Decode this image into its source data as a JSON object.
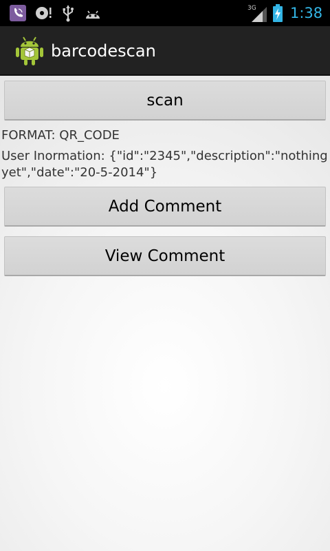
{
  "status_bar": {
    "time": "1:38",
    "network_type": "3G",
    "icons": [
      "viber-icon",
      "disc-icon",
      "usb-icon",
      "android-icon",
      "signal-icon",
      "battery-charging-icon"
    ],
    "clock_color": "#33b5e5"
  },
  "action_bar": {
    "title": "barcodescan",
    "icon": "android-app-icon",
    "brand_color": "#a4c639"
  },
  "main": {
    "scan_label": "scan",
    "format_line": "FORMAT: QR_CODE",
    "info_line1": "User Inormation: {\"id\":\"2345\",\"description\":\"nothing",
    "info_line2": "yet\",\"date\":\"20-5-2014\"}",
    "add_comment_label": "Add Comment",
    "view_comment_label": "View Comment"
  }
}
